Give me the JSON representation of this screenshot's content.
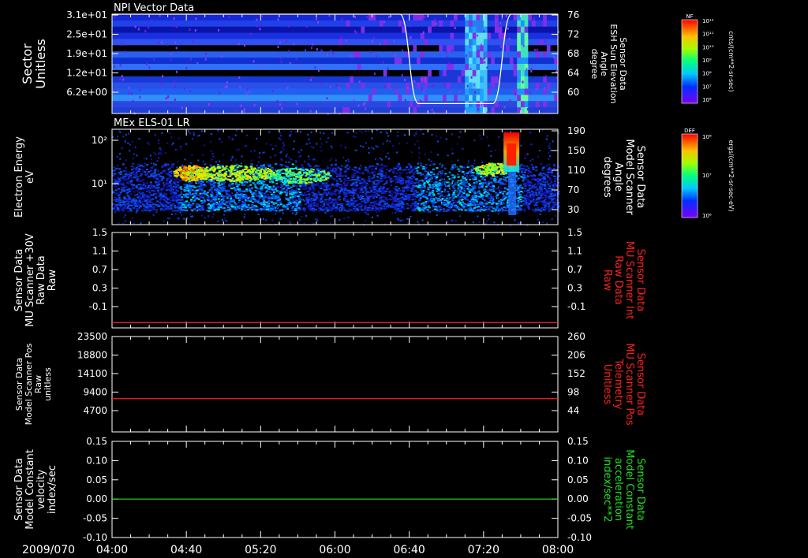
{
  "date_label": "2009/070",
  "time_ticks": [
    "04:00",
    "04:40",
    "05:20",
    "06:00",
    "06:40",
    "07:20",
    "08:00"
  ],
  "colors": {
    "background": "#000000",
    "axes": "#ffffff",
    "red_trace": "#ff2020",
    "green_trace": "#20e020",
    "white_trace": "#ffffff"
  },
  "panels": [
    {
      "title": "NPI Vector Data",
      "left_label": [
        "Sector",
        "Unitless"
      ],
      "left_ticks": [
        "3.1e+01",
        "2.5e+01",
        "1.9e+01",
        "1.2e+01",
        "6.2e+00"
      ],
      "right_label": [
        "Sensor Data",
        "ESH Sun Elevation",
        "Angle",
        "degree"
      ],
      "right_ticks": [
        "76",
        "72",
        "68",
        "64",
        "60"
      ],
      "colorbar": {
        "tag": "NF",
        "top": "10¹²",
        "bottom": "10⁶",
        "ticks": [
          "10¹²",
          "10¹¹",
          "10¹⁰",
          "10⁹",
          "10⁸",
          "10⁷",
          "10⁶"
        ],
        "units": "cnts/(cm**2-sr-sec)"
      }
    },
    {
      "title": "MEx ELS-01 LR",
      "left_label": [
        "Electron Energy",
        "eV"
      ],
      "left_ticks": [
        "10²",
        "10¹"
      ],
      "right_label": [
        "Sensor Data",
        "Model Scanner",
        "Angle",
        "degrees"
      ],
      "right_ticks": [
        "190",
        "150",
        "110",
        "70",
        "30"
      ],
      "colorbar": {
        "tag": "DEF",
        "top": "10⁸",
        "mid": "10⁷",
        "bottom": "10⁶",
        "units": "ergs/(cm**2-sr-sec-eV)"
      }
    },
    {
      "left_label": [
        "Sensor Data",
        "MU Scanner +30V",
        "Raw Data",
        "Raw"
      ],
      "left_ticks": [
        "1.5",
        "1.1",
        "0.7",
        "0.3",
        "-0.1"
      ],
      "right_label": [
        "Sensor Data",
        "MU Scanner Int",
        "Raw Data",
        "Raw"
      ],
      "right_ticks": [
        "1.5",
        "1.1",
        "0.7",
        "0.3",
        "-0.1"
      ]
    },
    {
      "left_label": [
        "Sensor Data",
        "Model Scanner Pos",
        "Raw",
        "unitless"
      ],
      "left_ticks": [
        "23500",
        "18800",
        "14100",
        "9400",
        "4700"
      ],
      "right_label": [
        "Sensor Data",
        "MU Scanner Pos",
        "Telemetry",
        "Unitless"
      ],
      "right_ticks": [
        "260",
        "206",
        "152",
        "98",
        "44"
      ]
    },
    {
      "left_label": [
        "Sensor Data",
        "Model Constant",
        "velocity",
        "index/sec"
      ],
      "left_ticks": [
        "0.15",
        "0.10",
        "0.05",
        "0.00",
        "-0.05",
        "-0.10"
      ],
      "right_label": [
        "Sensor Data",
        "Model Constant",
        "acceleration",
        "index/sec**2"
      ],
      "right_ticks": [
        "0.15",
        "0.10",
        "0.05",
        "0.00",
        "-0.05",
        "-0.10"
      ]
    }
  ],
  "chart_data": [
    {
      "type": "heatmap",
      "title": "NPI Vector Data",
      "x": [
        "04:00",
        "08:00"
      ],
      "ylabel": "Sector Unitless",
      "series": [
        {
          "name": "ESH Sun Elevation Angle",
          "x": [
            "04:00",
            "06:35",
            "06:45",
            "07:25",
            "07:35",
            "08:00"
          ],
          "values": [
            76,
            76,
            58,
            58,
            76,
            76
          ]
        }
      ]
    },
    {
      "type": "heatmap",
      "title": "MEx ELS-01 LR",
      "x": [
        "04:00",
        "08:00"
      ],
      "ylabel": "Electron Energy eV"
    },
    {
      "type": "line",
      "x": [
        "04:00",
        "08:00"
      ],
      "ylim": [
        -0.3,
        1.5
      ],
      "series": [
        {
          "name": "MU Scanner Int Raw Data",
          "values": [
            -0.2,
            -0.2
          ]
        }
      ]
    },
    {
      "type": "line",
      "x": [
        "04:00",
        "08:00"
      ],
      "ylim": [
        0,
        23500
      ],
      "series": [
        {
          "name": "MU Scanner Pos Telemetry",
          "values": [
            8200,
            8200
          ]
        }
      ]
    },
    {
      "type": "line",
      "x": [
        "04:00",
        "08:00"
      ],
      "ylim": [
        -0.1,
        0.15
      ],
      "series": [
        {
          "name": "Model Constant acceleration",
          "values": [
            0.0,
            0.0
          ]
        }
      ]
    }
  ]
}
